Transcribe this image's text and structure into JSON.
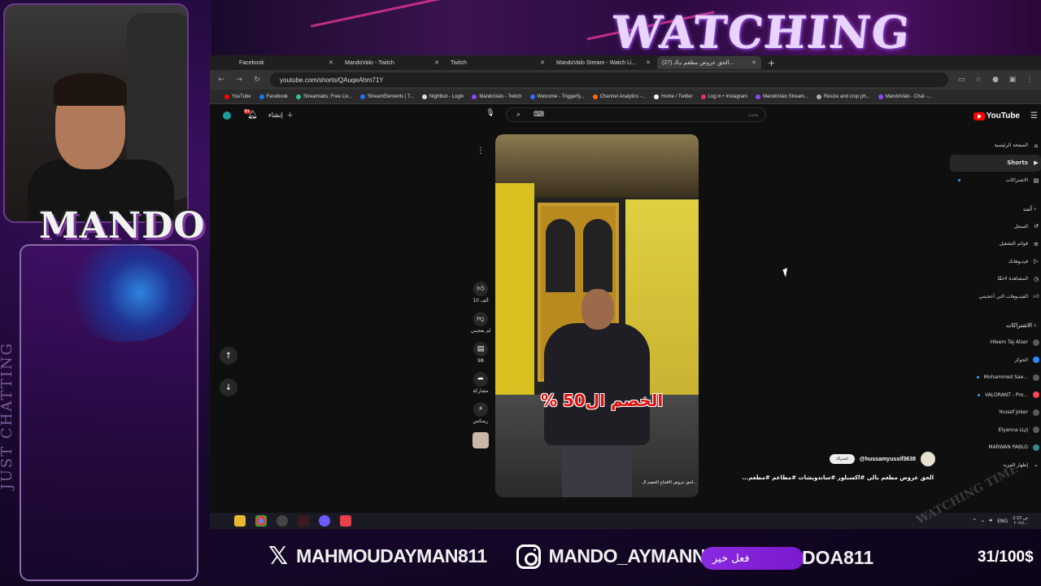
{
  "overlay": {
    "title": "WATCHING TIME",
    "streamer_logo": "MANDO",
    "category_vertical": "JUST CHATTING",
    "x_handle": "MAHMOUDAYMAN811",
    "instagram_handle": "MANDO_AYMANN",
    "donation_alert": "فعل خير",
    "donation_tail": "DOA811",
    "goal": "31/100$",
    "watermark": "WATCHING TIME"
  },
  "browser": {
    "tabs": [
      {
        "label": "Facebook",
        "active": false
      },
      {
        "label": "MandoValo - Twitch",
        "active": false
      },
      {
        "label": "Twitch",
        "active": false
      },
      {
        "label": "MandoValo Stream - Watch Li...",
        "active": false
      },
      {
        "label": "(27) الحق عروض مطعم بـالـ...",
        "active": true
      }
    ],
    "new_tab": "+",
    "url": "youtube.com/shorts/QAuqeAhm71Y",
    "bookmarks": [
      {
        "label": "YouTube",
        "color": "#ff0000"
      },
      {
        "label": "Facebook",
        "color": "#1877f2"
      },
      {
        "label": "Streamlabs: Free Liv...",
        "color": "#31c3a2"
      },
      {
        "label": "StreamElements | T...",
        "color": "#2a6aff"
      },
      {
        "label": "Nightbot - Login",
        "color": "#dddddd"
      },
      {
        "label": "MandoValo - Twitch",
        "color": "#9146ff"
      },
      {
        "label": "Welcome - Triggerfy...",
        "color": "#3a6aff"
      },
      {
        "label": "Channel Analytics -...",
        "color": "#ff6a00"
      },
      {
        "label": "Home / Twitter",
        "color": "#ffffff"
      },
      {
        "label": "Log in • Instagram",
        "color": "#e1306c"
      },
      {
        "label": "MandoValo Stream...",
        "color": "#9146ff"
      },
      {
        "label": "Resize and crop ph...",
        "color": "#aaaaaa"
      },
      {
        "label": "MandoValo - Chat -...",
        "color": "#9146ff"
      }
    ]
  },
  "youtube": {
    "logo_text": "YouTube",
    "create_label": "إنشاء",
    "notifications_badge": "9+",
    "search_placeholder": "بحث",
    "sidebar": {
      "main": [
        {
          "label": "الصفحة الرئيسية",
          "icon": "home-icon",
          "active": false
        },
        {
          "label": "Shorts",
          "icon": "shorts-icon",
          "active": true
        },
        {
          "label": "الاشتراكات",
          "icon": "subscriptions-icon",
          "active": false
        }
      ],
      "you_header": "أنت",
      "you": [
        {
          "label": "السجل",
          "icon": "history-icon"
        },
        {
          "label": "قوائم التشغيل",
          "icon": "playlist-icon"
        },
        {
          "label": "فيديوهاتك",
          "icon": "video-icon"
        },
        {
          "label": "المشاهدة لاحقًا",
          "icon": "clock-icon"
        },
        {
          "label": "الفيديوهات التي أعجبتني",
          "icon": "like-icon"
        }
      ],
      "subs_header": "الاشتراكات",
      "subscriptions": [
        {
          "label": "Hleem Taj Alser",
          "live": false
        },
        {
          "label": "الجوكر",
          "live": false
        },
        {
          "label": "Mohammed Sae...",
          "live": true
        },
        {
          "label": "VALORANT - Pro...",
          "live": true
        },
        {
          "label": "Yousef Joker",
          "live": false
        },
        {
          "label": "Elyanna إليانا",
          "live": false
        },
        {
          "label": "MARWAN PABLO",
          "live": false
        },
        {
          "label": "إظهار المزيد",
          "live": false
        }
      ]
    },
    "short": {
      "overlay_text": "الخصم ال50 %",
      "subtitle": "...لحق عروض الافتتاح الخصم ال",
      "actions": [
        {
          "name": "like",
          "icon": "thumb-up-icon",
          "label": "10 ألف"
        },
        {
          "name": "dislike",
          "icon": "thumb-down-icon",
          "label": "لم يعجبني"
        },
        {
          "name": "comments",
          "icon": "comment-icon",
          "label": "98"
        },
        {
          "name": "share",
          "icon": "share-icon",
          "label": "مشاركة"
        },
        {
          "name": "remix",
          "icon": "remix-icon",
          "label": "ريمكس"
        }
      ],
      "channel": "@hussamyussif3638",
      "subscribe_label": "اشتراك",
      "title": "الحق عروض مطعم بالي #اكسبلور #ساندويشات #مطاعم #مطعم..."
    }
  },
  "taskbar": {
    "language": "ENG",
    "time": "2:15 ص",
    "date": "٢٠٢٤/..."
  }
}
